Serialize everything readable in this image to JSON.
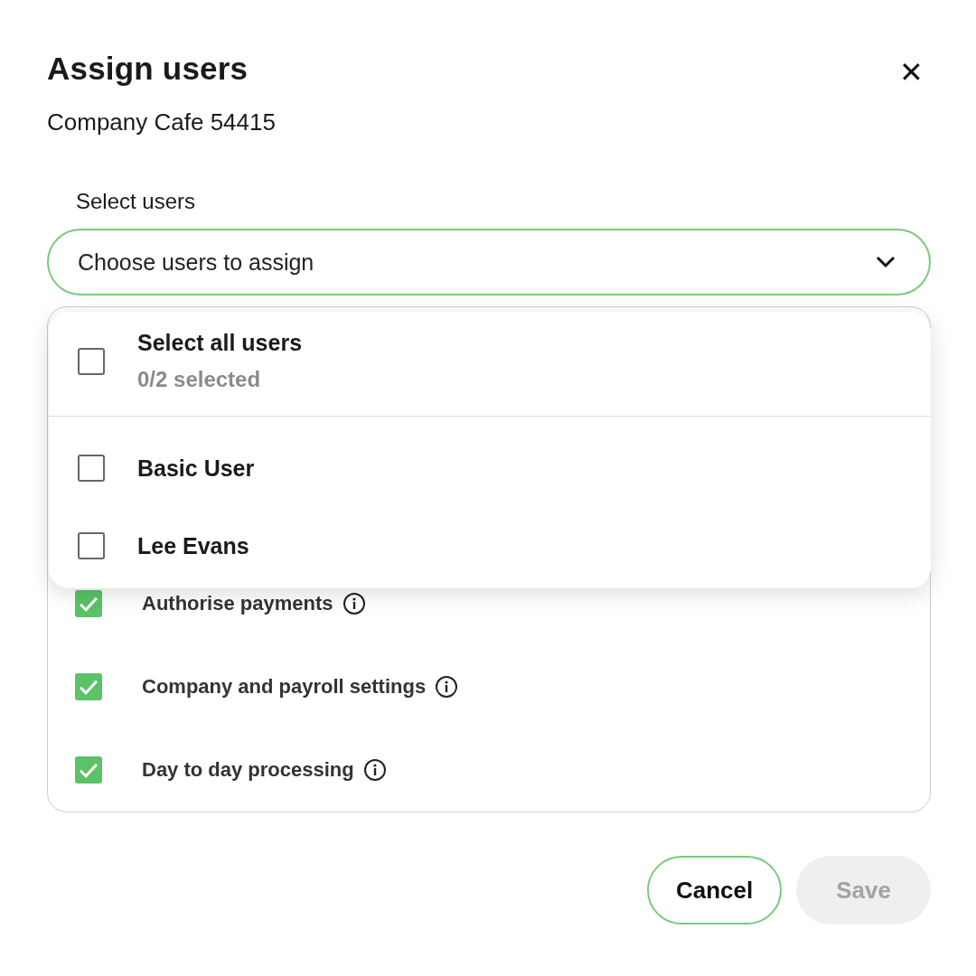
{
  "dialog": {
    "title": "Assign users",
    "subtitle": "Company Cafe 54415",
    "close": "✕"
  },
  "select_users": {
    "label": "Select users",
    "placeholder": "Choose users to assign",
    "expanded": true
  },
  "dropdown": {
    "select_all": {
      "label": "Select all users",
      "count": "0/2 selected",
      "checked": false
    },
    "users": [
      {
        "name": "Basic User",
        "checked": false
      },
      {
        "name": "Lee Evans",
        "checked": false
      }
    ]
  },
  "permissions": [
    {
      "label": "Authorise payments",
      "checked": true
    },
    {
      "label": "Company and payroll settings",
      "checked": true
    },
    {
      "label": "Day to day processing",
      "checked": true
    }
  ],
  "buttons": {
    "cancel": "Cancel",
    "save": "Save",
    "save_disabled": true
  }
}
